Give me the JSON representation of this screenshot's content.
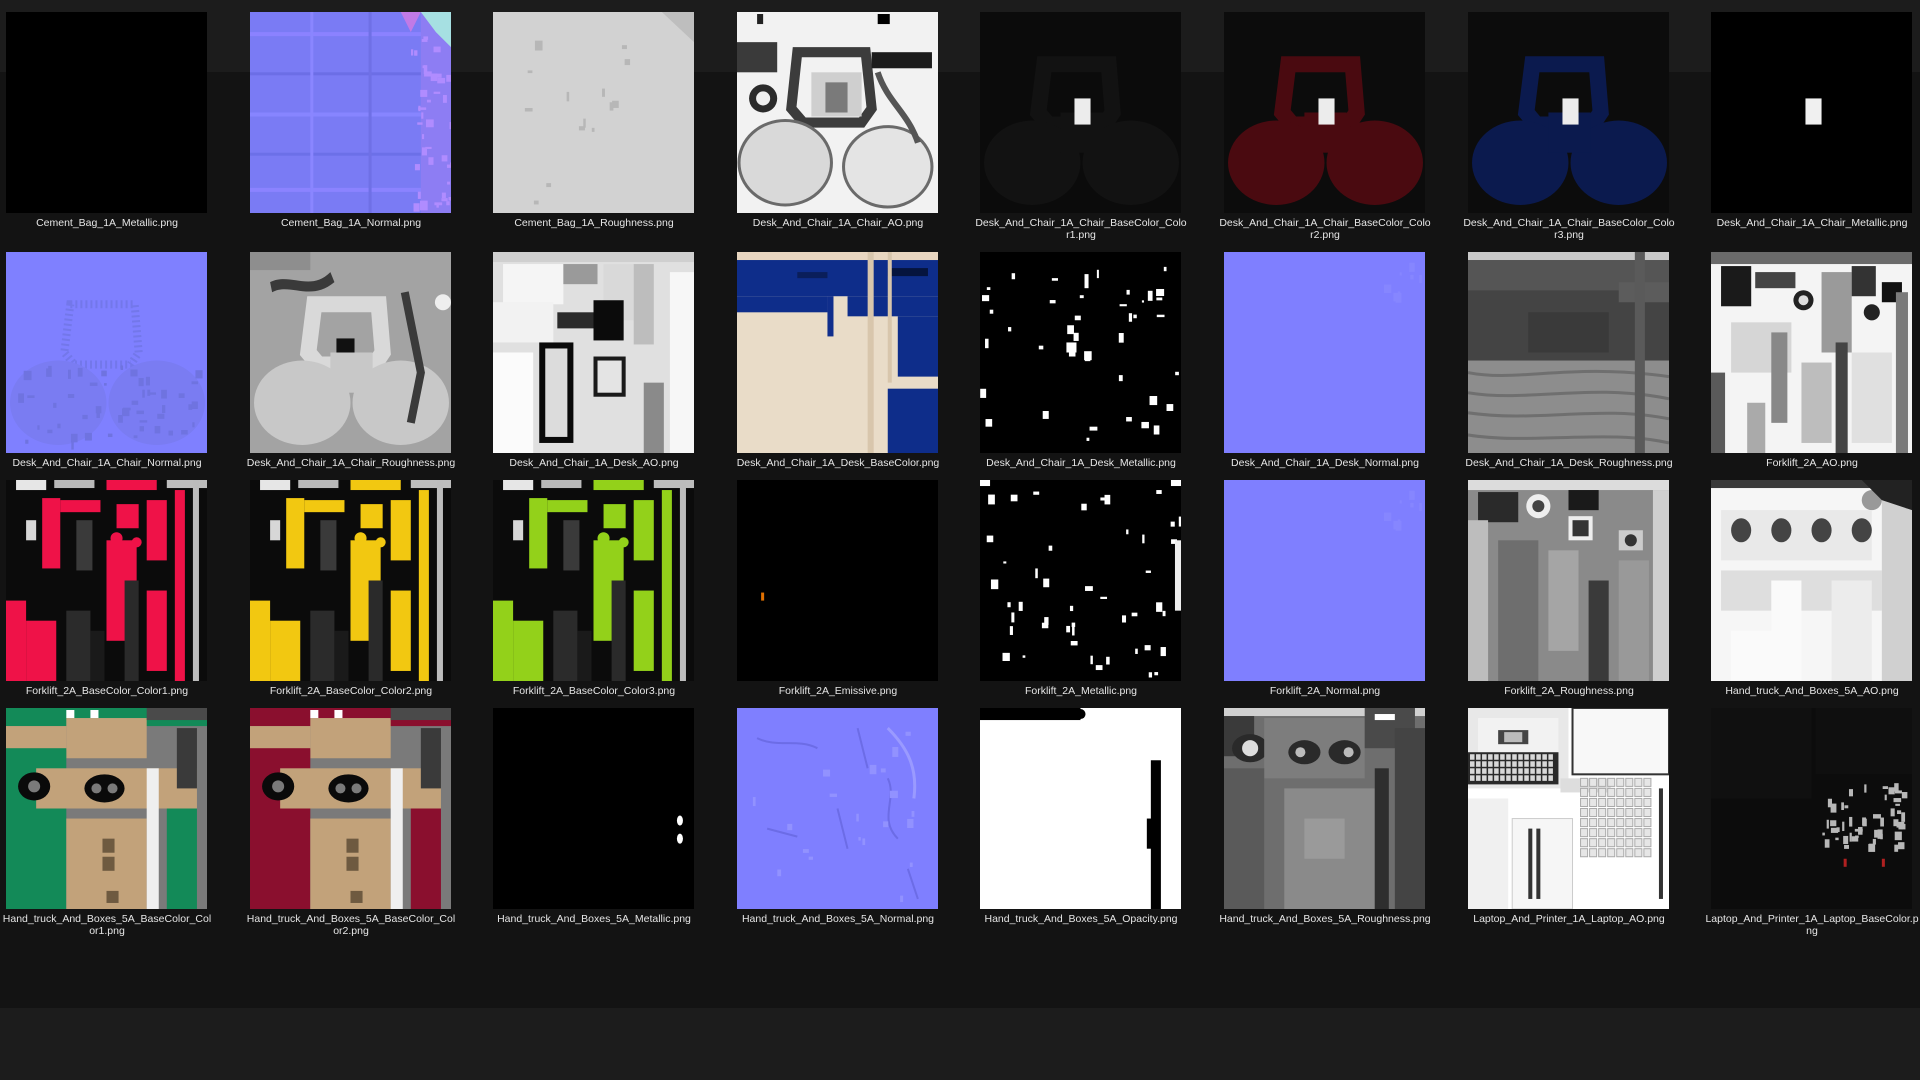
{
  "files": [
    {
      "name": "Cement_Bag_1A_Metallic.png",
      "thumb": "black"
    },
    {
      "name": "Cement_Bag_1A_Normal.png",
      "thumb": "normal-noisy"
    },
    {
      "name": "Cement_Bag_1A_Roughness.png",
      "thumb": "light-gray"
    },
    {
      "name": "Desk_And_Chair_1A_Chair_AO.png",
      "thumb": "chair-ao"
    },
    {
      "name": "Desk_And_Chair_1A_Chair_BaseColor_Color1.png",
      "thumb": "chair-dark"
    },
    {
      "name": "Desk_And_Chair_1A_Chair_BaseColor_Color2.png",
      "thumb": "chair-red"
    },
    {
      "name": "Desk_And_Chair_1A_Chair_BaseColor_Color3.png",
      "thumb": "chair-blue"
    },
    {
      "name": "Desk_And_Chair_1A_Chair_Metallic.png",
      "thumb": "chair-metallic"
    },
    {
      "name": "Desk_And_Chair_1A_Chair_Normal.png",
      "thumb": "chair-normal"
    },
    {
      "name": "Desk_And_Chair_1A_Chair_Roughness.png",
      "thumb": "chair-rough"
    },
    {
      "name": "Desk_And_Chair_1A_Desk_AO.png",
      "thumb": "desk-ao"
    },
    {
      "name": "Desk_And_Chair_1A_Desk_BaseColor.png",
      "thumb": "desk-base"
    },
    {
      "name": "Desk_And_Chair_1A_Desk_Metallic.png",
      "thumb": "desk-metallic"
    },
    {
      "name": "Desk_And_Chair_1A_Desk_Normal.png",
      "thumb": "normal-flat"
    },
    {
      "name": "Desk_And_Chair_1A_Desk_Roughness.png",
      "thumb": "desk-rough"
    },
    {
      "name": "Forklift_2A_AO.png",
      "thumb": "forklift-ao"
    },
    {
      "name": "Forklift_2A_BaseColor_Color1.png",
      "thumb": "forklift-red"
    },
    {
      "name": "Forklift_2A_BaseColor_Color2.png",
      "thumb": "forklift-yellow"
    },
    {
      "name": "Forklift_2A_BaseColor_Color3.png",
      "thumb": "forklift-green"
    },
    {
      "name": "Forklift_2A_Emissive.png",
      "thumb": "emissive"
    },
    {
      "name": "Forklift_2A_Metallic.png",
      "thumb": "forklift-metallic"
    },
    {
      "name": "Forklift_2A_Normal.png",
      "thumb": "normal-flat"
    },
    {
      "name": "Forklift_2A_Roughness.png",
      "thumb": "forklift-rough"
    },
    {
      "name": "Hand_truck_And_Boxes_5A_AO.png",
      "thumb": "handtruck-ao"
    },
    {
      "name": "Hand_truck_And_Boxes_5A_BaseColor_Color1.png",
      "thumb": "handtruck-green"
    },
    {
      "name": "Hand_truck_And_Boxes_5A_BaseColor_Color2.png",
      "thumb": "handtruck-maroon"
    },
    {
      "name": "Hand_truck_And_Boxes_5A_Metallic.png",
      "thumb": "handtruck-metallic"
    },
    {
      "name": "Hand_truck_And_Boxes_5A_Normal.png",
      "thumb": "handtruck-normal"
    },
    {
      "name": "Hand_truck_And_Boxes_5A_Opacity.png",
      "thumb": "opacity"
    },
    {
      "name": "Hand_truck_And_Boxes_5A_Roughness.png",
      "thumb": "handtruck-rough"
    },
    {
      "name": "Laptop_And_Printer_1A_Laptop_AO.png",
      "thumb": "laptop-ao"
    },
    {
      "name": "Laptop_And_Printer_1A_Laptop_BaseColor.png",
      "thumb": "laptop-base"
    }
  ]
}
